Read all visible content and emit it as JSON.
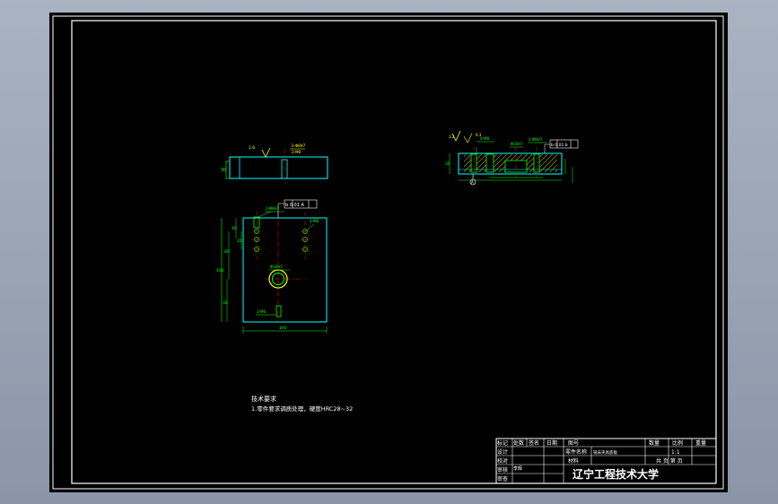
{
  "notes": {
    "heading": "技术要求",
    "line1": "1.零件要求调质处理，硬度HRC28~32"
  },
  "title_block": {
    "h_mark": "标记",
    "h_count": "处数",
    "h_sign": "签名",
    "h_date": "日期",
    "h_drawno": "图号",
    "h_qty": "数量",
    "h_scale": "比例",
    "h_weight": "重量",
    "r_design": "设计",
    "r_check": "校对",
    "r_audit": "审核",
    "r_review": "审查",
    "part_name_label": "零件名称",
    "part_name": "铣床夹具底板",
    "scale_value": "1:1",
    "material_label": "材料",
    "sheets": "共 页 第 页",
    "designer": "李辉",
    "school": "辽宁工程技术大学"
  },
  "dims": {
    "width": "160",
    "height": "190",
    "h1": "30",
    "h2": "40",
    "v1": "80",
    "d1": "2-Φ8H7",
    "d2": "4-M8",
    "d3": "Φ30H7",
    "d4": "2-M6",
    "tol1": "b 0.01 A",
    "tol2": "b 0.01 A",
    "tol3": "b 0.01 b",
    "dA": "A",
    "d5": "2-Φ8H7",
    "d6": "2-M8",
    "d7": "4-M8",
    "d8": "Φ30H7",
    "t1": "20",
    "t2": "30",
    "s1": "1.6",
    "s2": "3.2",
    "s3": "6.3"
  }
}
